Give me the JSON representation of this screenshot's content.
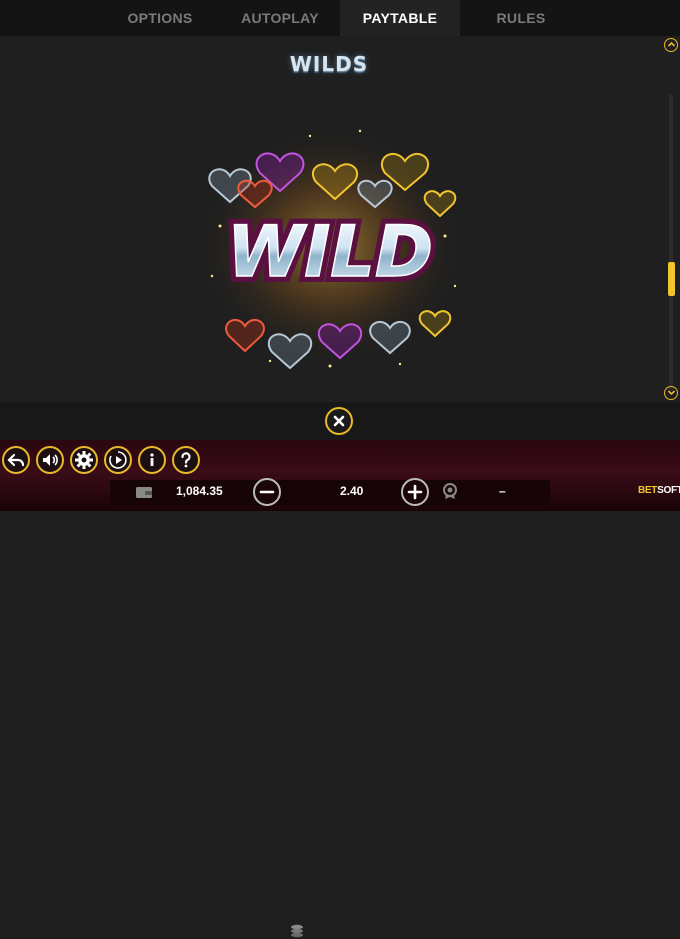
{
  "tabs": [
    {
      "label": "OPTIONS",
      "active": false
    },
    {
      "label": "AUTOPLAY",
      "active": false
    },
    {
      "label": "PAYTABLE",
      "active": true
    },
    {
      "label": "RULES",
      "active": false
    }
  ],
  "paytable": {
    "section_title": "WILDS",
    "symbol_text": "WILD"
  },
  "controls": [
    {
      "name": "back",
      "icon": "back-arrow-icon"
    },
    {
      "name": "sound",
      "icon": "speaker-icon"
    },
    {
      "name": "settings",
      "icon": "gear-icon"
    },
    {
      "name": "autoplay",
      "icon": "autoplay-icon"
    },
    {
      "name": "info",
      "icon": "info-icon"
    },
    {
      "name": "help",
      "icon": "question-icon"
    }
  ],
  "balance": {
    "icon": "wallet-icon",
    "value": "1,084.35"
  },
  "bet": {
    "icon": "coins-icon",
    "value": "2.40"
  },
  "win": {
    "icon": "medal-icon",
    "value": "–"
  },
  "brand": {
    "part1": "BET",
    "part2": "SOFT"
  },
  "colors": {
    "accent": "#e9b929",
    "tab_active_bg": "#232323",
    "bottom_bar": "#3a0c17"
  }
}
